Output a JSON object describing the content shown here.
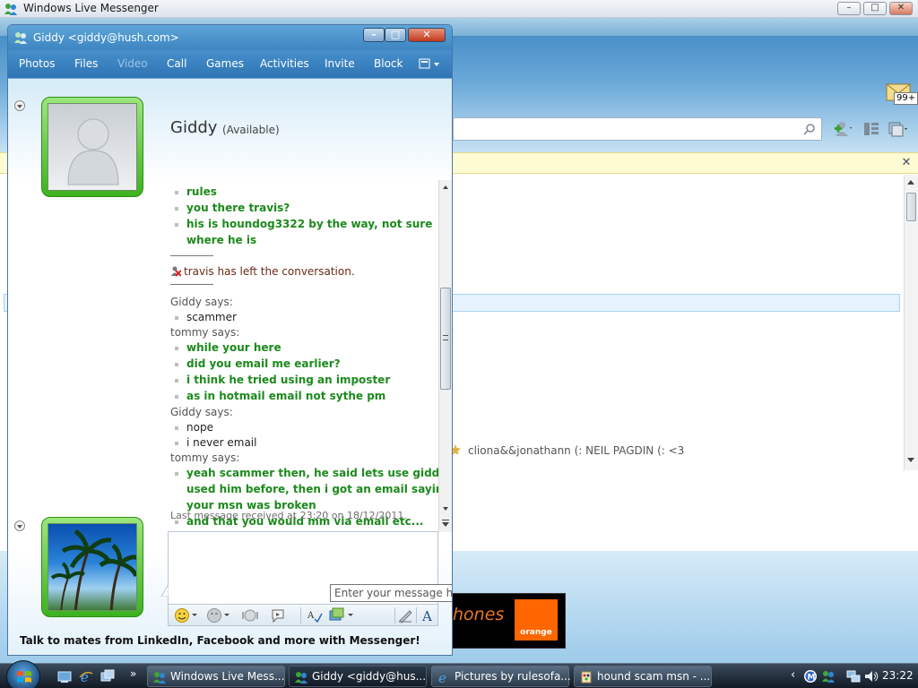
{
  "bg_window": {
    "title": "Windows Live Messenger",
    "controls": [
      "–",
      "□",
      "✕"
    ],
    "mail_count": "99+",
    "info_close": "✕",
    "status_line": "cliona&&jonathann (:   NEIL PAGDIN (: <3",
    "ad": {
      "text": "hones",
      "logo": "orange"
    }
  },
  "conversation": {
    "title": "Giddy <giddy@hush.com>",
    "controls": [
      "–",
      "□",
      "✕"
    ],
    "toolbar": [
      "Photos",
      "Files",
      "Video",
      "Call",
      "Games",
      "Activities",
      "Invite",
      "Block"
    ],
    "contact_name": "Giddy",
    "contact_status": "(Available)",
    "history": [
      {
        "kind": "msg-green",
        "text": "rules"
      },
      {
        "kind": "msg-green",
        "text": "you there travis?"
      },
      {
        "kind": "msg-green",
        "text": "his is houndog3322 by the way, not sure"
      },
      {
        "kind": "cont-green",
        "text": "where he is"
      },
      {
        "kind": "hr"
      },
      {
        "kind": "left",
        "text": "travis has left the conversation."
      },
      {
        "kind": "hr"
      },
      {
        "kind": "says",
        "text": "Giddy says:"
      },
      {
        "kind": "msg-black",
        "text": "scammer"
      },
      {
        "kind": "says",
        "text": "tommy says:"
      },
      {
        "kind": "msg-green",
        "text": "while your here"
      },
      {
        "kind": "msg-green",
        "text": "did you email me earlier?"
      },
      {
        "kind": "msg-green",
        "text": "i think he tried using an imposter"
      },
      {
        "kind": "msg-green",
        "text": "as in hotmail email not sythe pm"
      },
      {
        "kind": "says",
        "text": "Giddy says:"
      },
      {
        "kind": "msg-black",
        "text": "nope"
      },
      {
        "kind": "msg-black",
        "text": "i never email"
      },
      {
        "kind": "says",
        "text": "tommy says:"
      },
      {
        "kind": "msg-green",
        "text": "yeah scammer then, he said lets use giddy i"
      },
      {
        "kind": "cont-green",
        "text": "used him before, then i got an email saying"
      },
      {
        "kind": "cont-green",
        "text": "your msn was broken"
      },
      {
        "kind": "msg-green",
        "text": "and that you would mm via email etc..."
      }
    ],
    "last_received": "Last message received at 23:20 on 18/12/2011.",
    "input_value": "",
    "tooltip": "Enter your message here",
    "promo": "Talk to mates from LinkedIn, Facebook and more with Messenger!",
    "format_icons": [
      "emoticon-icon",
      "wink-icon",
      "nudge-icon",
      "voice-clip-icon",
      "spell-check-icon",
      "background-icon",
      "handwriting-icon",
      "font-icon"
    ],
    "font_glyph": "A"
  },
  "taskbar": {
    "quick_launch_more": "»",
    "tasks": [
      {
        "label": "Windows Live Mess...",
        "active": false
      },
      {
        "label": "Giddy <giddy@hus...",
        "active": true
      },
      {
        "label": "Pictures by rulesofa...",
        "active": false
      },
      {
        "label": "hound scam msn - ...",
        "active": false
      }
    ],
    "tray_chevron": "‹",
    "clock": "23:22"
  },
  "colors": {
    "green_message": "#1c8a1c",
    "toolbar_blue": "#2f74b4",
    "accent_green": "#3cb220"
  }
}
